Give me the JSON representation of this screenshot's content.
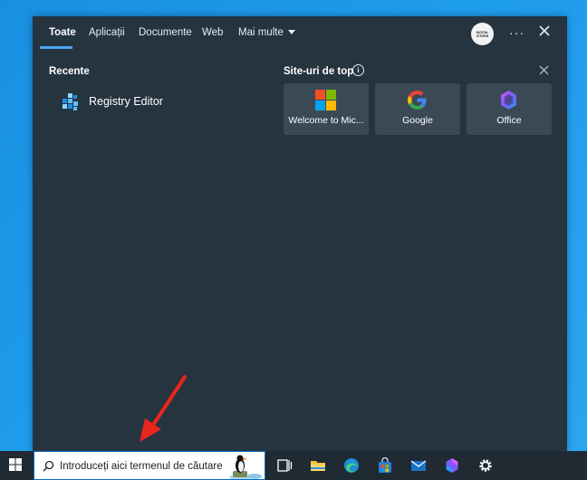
{
  "tabs": [
    {
      "label": "Toate",
      "active": true
    },
    {
      "label": "Aplicații",
      "active": false
    },
    {
      "label": "Documente",
      "active": false
    },
    {
      "label": "Web",
      "active": false
    },
    {
      "label": "Mai multe",
      "active": false
    }
  ],
  "account": {
    "avatar_text": "DIGITAL CITIZEN"
  },
  "recent": {
    "title": "Recente",
    "items": [
      {
        "label": "Registry Editor",
        "icon": "registry-editor-icon"
      }
    ]
  },
  "top_sites": {
    "title": "Site-uri de top",
    "sites": [
      {
        "label": "Welcome to Mic...",
        "icon": "microsoft-logo-icon"
      },
      {
        "label": "Google",
        "icon": "google-logo-icon"
      },
      {
        "label": "Office",
        "icon": "office-logo-icon"
      }
    ]
  },
  "taskbar": {
    "search_placeholder": "Introduceți aici termenul de căutare",
    "apps": [
      "task-view-icon",
      "file-explorer-icon",
      "edge-icon",
      "store-icon",
      "mail-icon",
      "copilot-icon",
      "settings-icon"
    ]
  },
  "colors": {
    "panel_bg": "#263440",
    "card_bg": "#3b4955",
    "accent": "#4ea6f5",
    "taskbar_bg": "#1f2a33",
    "arrow": "#e8261c"
  }
}
